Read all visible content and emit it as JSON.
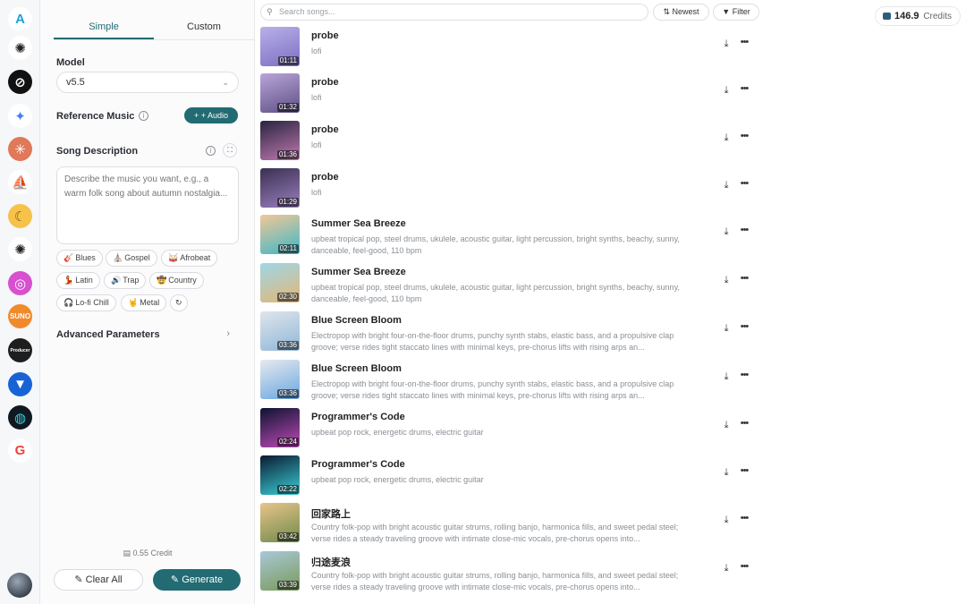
{
  "rail": {
    "apps": [
      {
        "name": "app-logo-a",
        "glyph": "A",
        "bg": "#ffffff",
        "fg": "#1aa3d9"
      },
      {
        "name": "openai-icon",
        "glyph": "✺",
        "bg": "#ffffff",
        "fg": "#222222"
      },
      {
        "name": "circle-slash-icon",
        "glyph": "⊘",
        "bg": "#111111",
        "fg": "#ffffff"
      },
      {
        "name": "gemini-icon",
        "glyph": "✦",
        "bg": "#ffffff",
        "fg": "#4a7cf0"
      },
      {
        "name": "claude-icon",
        "glyph": "✳",
        "bg": "#e0785a",
        "fg": "#ffffff"
      },
      {
        "name": "sail-icon",
        "glyph": "⛵",
        "bg": "#ffffff",
        "fg": "#3c4a5c"
      },
      {
        "name": "banana-icon",
        "glyph": "☾",
        "bg": "#f6c24a",
        "fg": "#7a5a10"
      },
      {
        "name": "openai-icon-2",
        "glyph": "✺",
        "bg": "#ffffff",
        "fg": "#222222"
      },
      {
        "name": "gradient-ring-icon",
        "glyph": "◎",
        "bg": "#d84fd0",
        "fg": "#ffffff"
      },
      {
        "name": "suno-icon",
        "glyph": "SUNO",
        "bg": "#f08a2c",
        "fg": "#ffffff"
      },
      {
        "name": "producer-icon",
        "glyph": "Producer",
        "bg": "#1e1e1e",
        "fg": "#ffffff"
      },
      {
        "name": "shield-v-icon",
        "glyph": "▼",
        "bg": "#1763d6",
        "fg": "#ffffff"
      },
      {
        "name": "loop-icon",
        "glyph": "◍",
        "bg": "#101820",
        "fg": "#3ad0e0"
      },
      {
        "name": "google-icon",
        "glyph": "G",
        "bg": "#ffffff",
        "fg": "#e8453c"
      }
    ]
  },
  "panel": {
    "tabs": [
      "Simple",
      "Custom"
    ],
    "model_label": "Model",
    "model_value": "v5.5",
    "reference_label": "Reference Music",
    "audio_button": "+ + Audio",
    "description_label": "Song Description",
    "description_placeholder": "Describe the music you want, e.g., a warm folk song about autumn nostalgia...",
    "chips": [
      {
        "glyph": "🎸",
        "label": "Blues"
      },
      {
        "glyph": "⛪",
        "label": "Gospel"
      },
      {
        "glyph": "🥁",
        "label": "Afrobeat"
      },
      {
        "glyph": "💃",
        "label": "Latin"
      },
      {
        "glyph": "🔊",
        "label": "Trap"
      },
      {
        "glyph": "🤠",
        "label": "Country"
      },
      {
        "glyph": "🎧",
        "label": "Lo-fi Chill"
      },
      {
        "glyph": "🤘",
        "label": "Metal"
      }
    ],
    "advanced_label": "Advanced Parameters",
    "credit_cost": "0.55 Credit",
    "clear_button": "Clear All",
    "generate_button": "Generate"
  },
  "toolbar": {
    "search_placeholder": "Search songs...",
    "sort_label": "Newest",
    "filter_label": "Filter",
    "credits_value": "146.9",
    "credits_label": "Credits"
  },
  "songs": [
    {
      "title": "probe",
      "desc": "lofi",
      "duration": "01:11",
      "thumb": [
        "#b8b0e8",
        "#7c6fc4"
      ]
    },
    {
      "title": "probe",
      "desc": "lofi",
      "duration": "01:32",
      "thumb": [
        "#b9a6d8",
        "#5e4f86"
      ]
    },
    {
      "title": "probe",
      "desc": "lofi",
      "duration": "01:36",
      "thumb": [
        "#2a2440",
        "#c07ab0"
      ]
    },
    {
      "title": "probe",
      "desc": "lofi",
      "duration": "01:29",
      "thumb": [
        "#3a3050",
        "#9a7fc0"
      ]
    },
    {
      "title": "Summer Sea Breeze",
      "desc": "upbeat tropical pop, steel drums, ukulele, acoustic guitar, light percussion, bright synths, beachy, sunny, danceable, feel-good, 110 bpm",
      "duration": "02:11",
      "thumb": [
        "#f3c796",
        "#3cb8c8"
      ]
    },
    {
      "title": "Summer Sea Breeze",
      "desc": "upbeat tropical pop, steel drums, ukulele, acoustic guitar, light percussion, bright synths, beachy, sunny, danceable, feel-good, 110 bpm",
      "duration": "02:30",
      "thumb": [
        "#9fd6e6",
        "#e2b777"
      ]
    },
    {
      "title": "Blue Screen Bloom",
      "desc": "Electropop with bright four-on-the-floor drums, punchy synth stabs, elastic bass, and a propulsive clap groove; verse rides tight staccato lines with minimal keys, pre-chorus lifts with rising arps an...",
      "duration": "03:36",
      "thumb": [
        "#dfe5ec",
        "#8fb7d8"
      ]
    },
    {
      "title": "Blue Screen Bloom",
      "desc": "Electropop with bright four-on-the-floor drums, punchy synth stabs, elastic bass, and a propulsive clap groove; verse rides tight staccato lines with minimal keys, pre-chorus lifts with rising arps an...",
      "duration": "03:36",
      "thumb": [
        "#e6e9ef",
        "#6aa7e0"
      ]
    },
    {
      "title": "Programmer's Code",
      "desc": "upbeat pop rock, energetic drums, electric guitar",
      "duration": "02:24",
      "thumb": [
        "#0c1430",
        "#c04ab8"
      ]
    },
    {
      "title": "Programmer's Code",
      "desc": "upbeat pop rock, energetic drums, electric guitar",
      "duration": "02:22",
      "thumb": [
        "#0a1a30",
        "#3ad0d8"
      ]
    },
    {
      "title": "回家路上",
      "desc": "Country folk-pop with bright acoustic guitar strums, rolling banjo, harmonica fills, and sweet pedal steel; verse rides a steady traveling groove with intimate close-mic vocals, pre-chorus opens into...",
      "duration": "03:42",
      "thumb": [
        "#e8c48a",
        "#6f8a4a"
      ]
    },
    {
      "title": "归途麦浪",
      "desc": "Country folk-pop with bright acoustic guitar strums, rolling banjo, harmonica fills, and sweet pedal steel; verse rides a steady traveling groove with intimate close-mic vocals, pre-chorus opens into...",
      "duration": "03:39",
      "thumb": [
        "#a8c8d8",
        "#7a9a5a"
      ]
    }
  ]
}
